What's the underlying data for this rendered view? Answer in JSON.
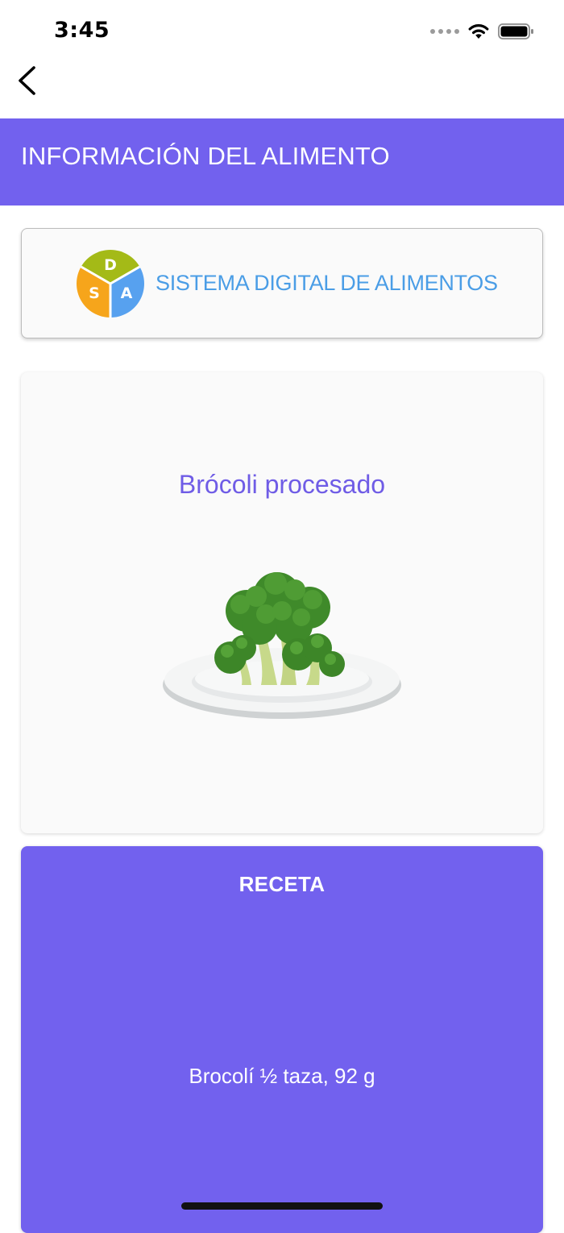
{
  "status_bar": {
    "time": "3:45",
    "icons": [
      "signal-dots-icon",
      "wifi-icon",
      "battery-icon"
    ]
  },
  "nav": {
    "back_icon": "chevron-left-icon"
  },
  "header": {
    "title": "INFORMACIÓN DEL ALIMENTO"
  },
  "logo": {
    "letters": [
      "D",
      "S",
      "A"
    ],
    "text": "SISTEMA DIGITAL DE ALIMENTOS"
  },
  "food": {
    "name": "Brócoli procesado",
    "image": "broccoli-on-plate"
  },
  "recipe": {
    "title": "RECETA",
    "text": "Brocolí ½ taza, 92 g"
  },
  "colors": {
    "accent": "#7261ee",
    "food_name": "#6f5ce6",
    "logo_text": "#4a9de6",
    "logo_green": "#a4ba17",
    "logo_orange": "#f6a51b",
    "logo_blue": "#57a1ef"
  }
}
